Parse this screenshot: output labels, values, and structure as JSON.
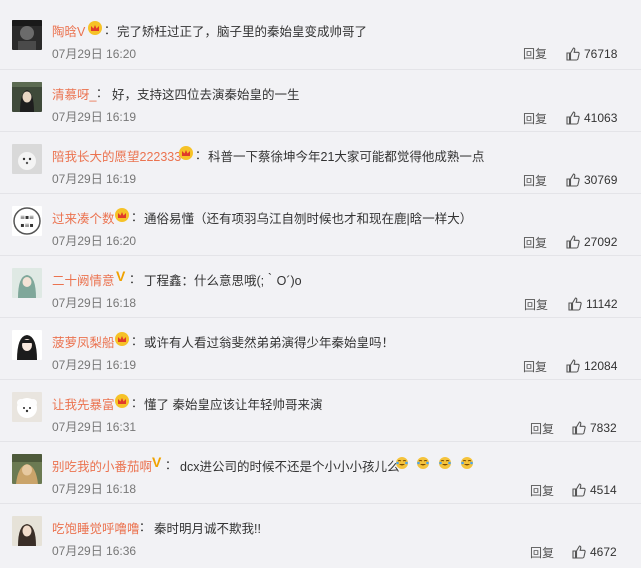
{
  "comments": [
    {
      "user": "陶晗V",
      "text": "完了矫枉过正了，脑子里的秦始皇变成帅哥了",
      "time": "07月29日 16:20",
      "reply": "回复",
      "likes": "76718",
      "badge": "crown"
    },
    {
      "user": "清慕呀_",
      "text": "好，支持这四位去演秦始皇的一生",
      "time": "07月29日 16:19",
      "reply": "回复",
      "likes": "41063",
      "badge": "none"
    },
    {
      "user": "陪我长大的愿望222333",
      "text": "科普一下蔡徐坤今年21大家可能都觉得他成熟一点",
      "time": "07月29日 16:19",
      "reply": "回复",
      "likes": "30769",
      "badge": "crown"
    },
    {
      "user": "过来凑个数",
      "text": "通俗易懂（还有项羽乌江自刎时候也才和现在鹿|晗一样大）",
      "time": "07月29日 16:20",
      "reply": "回复",
      "likes": "27092",
      "badge": "crown"
    },
    {
      "user": "二十阙情意",
      "text": "丁程鑫：什么意思哦(;｀O´)o",
      "time": "07月29日 16:18",
      "reply": "回复",
      "likes": "11142",
      "badge": "v"
    },
    {
      "user": "菠萝凤梨船",
      "text": "或许有人看过翁斐然弟弟演得少年秦始皇吗！",
      "time": "07月29日 16:19",
      "reply": "回复",
      "likes": "12084",
      "badge": "crown"
    },
    {
      "user": "让我先暴富",
      "text": "懂了 秦始皇应该让年轻帅哥来演",
      "time": "07月29日 16:31",
      "reply": "回复",
      "likes": "7832",
      "badge": "crown"
    },
    {
      "user": "别吃我的小番茄啊",
      "text": "dcx进公司的时候不还是个小小小孩儿么",
      "time": "07月29日 16:18",
      "reply": "回复",
      "likes": "4514",
      "badge": "v"
    },
    {
      "user": "吃饱睡觉呼噜噜",
      "text": "秦时明月诚不欺我!!",
      "time": "07月29日 16:36",
      "reply": "回复",
      "likes": "4672",
      "badge": "none"
    }
  ],
  "colors": {
    "username": "#eb7350",
    "crown_badge": "#f6c227",
    "v_badge": "#f0a200",
    "background": "#f2f2f5"
  },
  "icons": {
    "like": "thumbs-up-icon",
    "crown": "crown-badge-icon",
    "vip": "v-badge-icon",
    "emoji": "tears-of-joy-emoji-icon"
  }
}
